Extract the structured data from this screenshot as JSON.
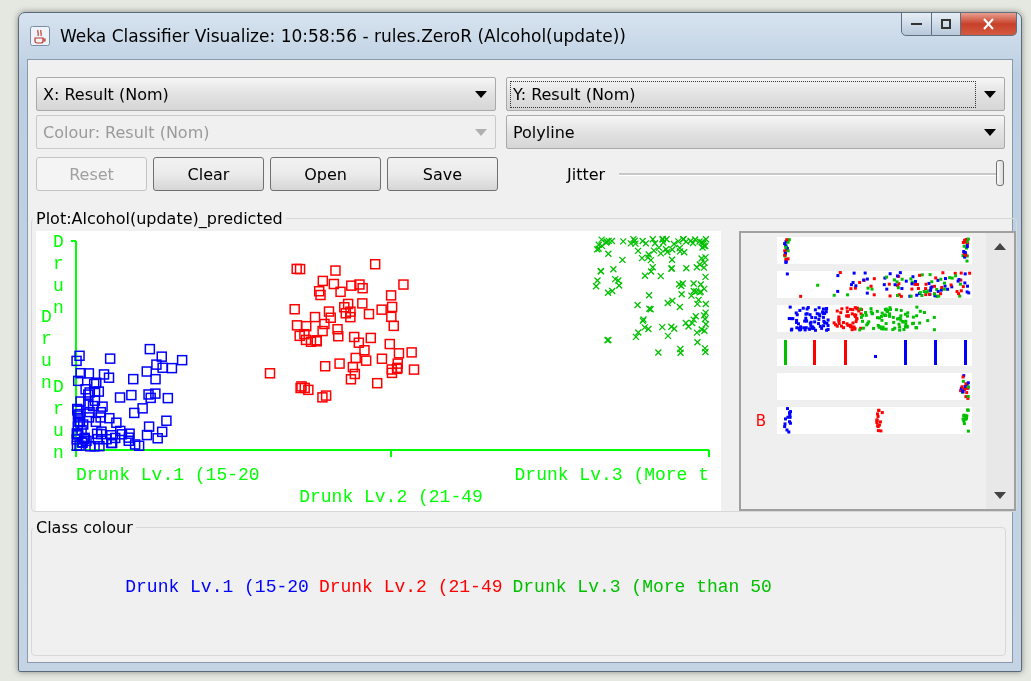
{
  "window": {
    "title": "Weka Classifier Visualize: 10:58:56 - rules.ZeroR (Alcohol(update))"
  },
  "combos": [
    {
      "value": "X: Result (Nom)",
      "disabled": false,
      "focused": false
    },
    {
      "value": "Y: Result (Nom)",
      "disabled": false,
      "focused": true
    },
    {
      "value": "Colour: Result (Nom)",
      "disabled": true,
      "focused": false
    },
    {
      "value": "Polyline",
      "disabled": false,
      "focused": false
    }
  ],
  "buttons": [
    {
      "label": "Reset",
      "disabled": true
    },
    {
      "label": "Clear",
      "disabled": false
    },
    {
      "label": "Open",
      "disabled": false
    },
    {
      "label": "Save",
      "disabled": false
    }
  ],
  "jitter": {
    "label": "Jitter",
    "level": 1
  },
  "plot": {
    "title": "Plot:Alcohol(update)_predicted",
    "x_labels": [
      "Drunk Lv.1 (15-20",
      "Drunk Lv.2 (21-49",
      "Drunk Lv.3 (More t"
    ],
    "y_labels": [
      "Drun",
      "Drun",
      "Drun"
    ]
  },
  "attribute_panel": {
    "strips": [
      {
        "kind": "edges"
      },
      {
        "kind": "spread"
      },
      {
        "kind": "cloud"
      },
      {
        "kind": "columns"
      },
      {
        "kind": "right"
      },
      {
        "kind": "clusters",
        "label": "B"
      }
    ]
  },
  "class_colour": {
    "title": "Class colour",
    "classes": [
      {
        "label": "Drunk Lv.1 (15-20",
        "color": "#0000ff"
      },
      {
        "label": "Drunk Lv.2 (21-49",
        "color": "#ff0000"
      },
      {
        "label": "Drunk Lv.3 (More than 50",
        "color": "#00c000"
      }
    ]
  }
}
